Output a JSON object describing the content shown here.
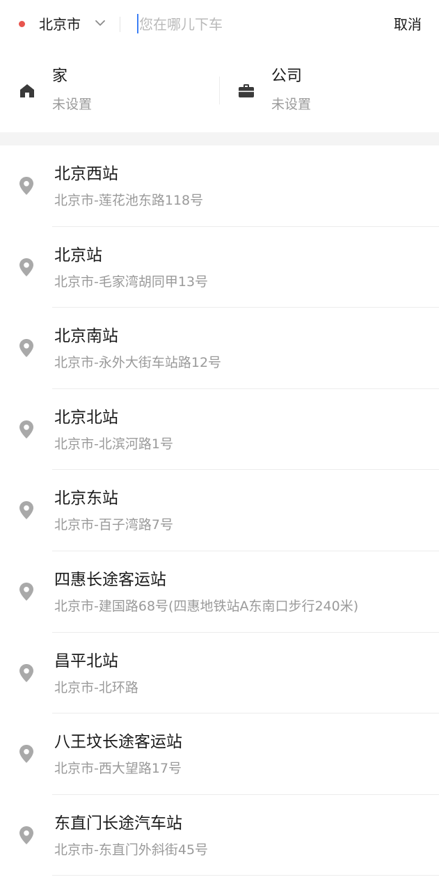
{
  "colors": {
    "city_dot": "#e8554e",
    "caret": "#3d7ff5",
    "icon_dark": "#3a3a3a",
    "pin_gray": "#a9a9a9",
    "subtext": "#9a9a9a"
  },
  "search": {
    "city": "北京市",
    "placeholder": "您在哪儿下车",
    "cancel": "取消"
  },
  "shortcuts": {
    "home": {
      "title": "家",
      "subtitle": "未设置",
      "icon": "home-icon"
    },
    "work": {
      "title": "公司",
      "subtitle": "未设置",
      "icon": "briefcase-icon"
    }
  },
  "results": [
    {
      "name": "北京西站",
      "address": "北京市-莲花池东路118号"
    },
    {
      "name": "北京站",
      "address": "北京市-毛家湾胡同甲13号"
    },
    {
      "name": "北京南站",
      "address": "北京市-永外大街车站路12号"
    },
    {
      "name": "北京北站",
      "address": "北京市-北滨河路1号"
    },
    {
      "name": "北京东站",
      "address": "北京市-百子湾路7号"
    },
    {
      "name": "四惠长途客运站",
      "address": "北京市-建国路68号(四惠地铁站A东南口步行240米)"
    },
    {
      "name": "昌平北站",
      "address": "北京市-北环路"
    },
    {
      "name": "八王坟长途客运站",
      "address": "北京市-西大望路17号"
    },
    {
      "name": "东直门长途汽车站",
      "address": "北京市-东直门外斜街45号"
    }
  ]
}
